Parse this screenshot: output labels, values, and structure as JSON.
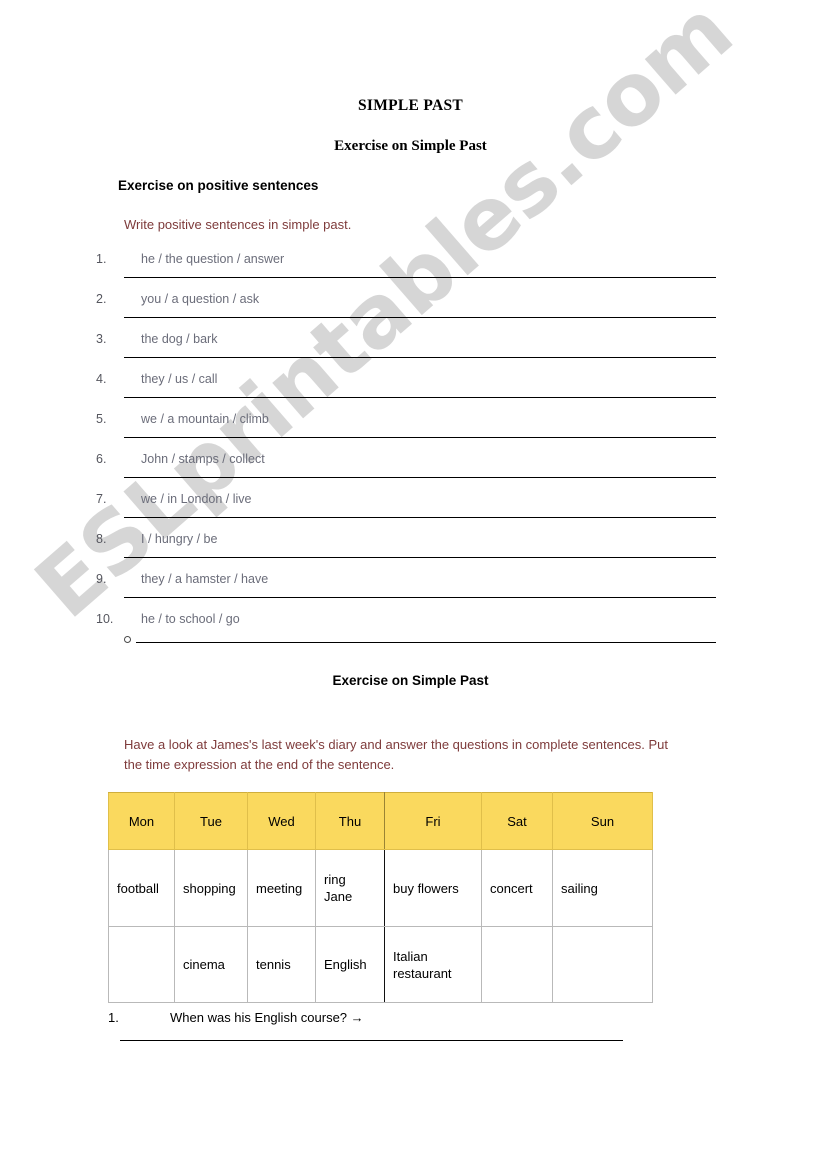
{
  "document": {
    "title": "SIMPLE PAST",
    "subtitle": "Exercise on Simple Past",
    "watermark": "ESLprintables.com"
  },
  "exercise1": {
    "heading": "Exercise on positive sentences",
    "instruction": "Write positive sentences in simple past.",
    "items": [
      {
        "num": "1.",
        "prompt": "he / the question / answer"
      },
      {
        "num": "2.",
        "prompt": "you / a question / ask"
      },
      {
        "num": "3.",
        "prompt": "the dog / bark"
      },
      {
        "num": "4.",
        "prompt": "they / us / call"
      },
      {
        "num": "5.",
        "prompt": "we / a mountain / climb"
      },
      {
        "num": "6.",
        "prompt": "John / stamps / collect"
      },
      {
        "num": "7.",
        "prompt": "we / in London / live"
      },
      {
        "num": "8.",
        "prompt": "I / hungry / be"
      },
      {
        "num": "9.",
        "prompt": "they / a hamster / have"
      },
      {
        "num": "10.",
        "prompt": "he / to school / go"
      }
    ]
  },
  "exercise2": {
    "heading": "Exercise on Simple Past",
    "instruction": "Have a look at James's last week's diary and answer the questions in complete sentences. Put the time expression at the end of the sentence.",
    "diary": {
      "columns": [
        "Mon",
        "Tue",
        "Wed",
        "Thu",
        "Fri",
        "Sat",
        "Sun"
      ],
      "rows": [
        [
          "football",
          "shopping",
          "meeting",
          "ring Jane",
          "buy flowers",
          "concert",
          "sailing"
        ],
        [
          "",
          "cinema",
          "tennis",
          "English",
          "Italian restaurant",
          "",
          ""
        ]
      ]
    },
    "questions": [
      {
        "num": "1.",
        "text": "When was his English course? →"
      }
    ]
  },
  "colors": {
    "table_header": "#fad95e",
    "instruction_text": "#7e3b3b",
    "list_text": "#6b6d7a",
    "watermark": "rgba(0,0,0,0.16)"
  }
}
